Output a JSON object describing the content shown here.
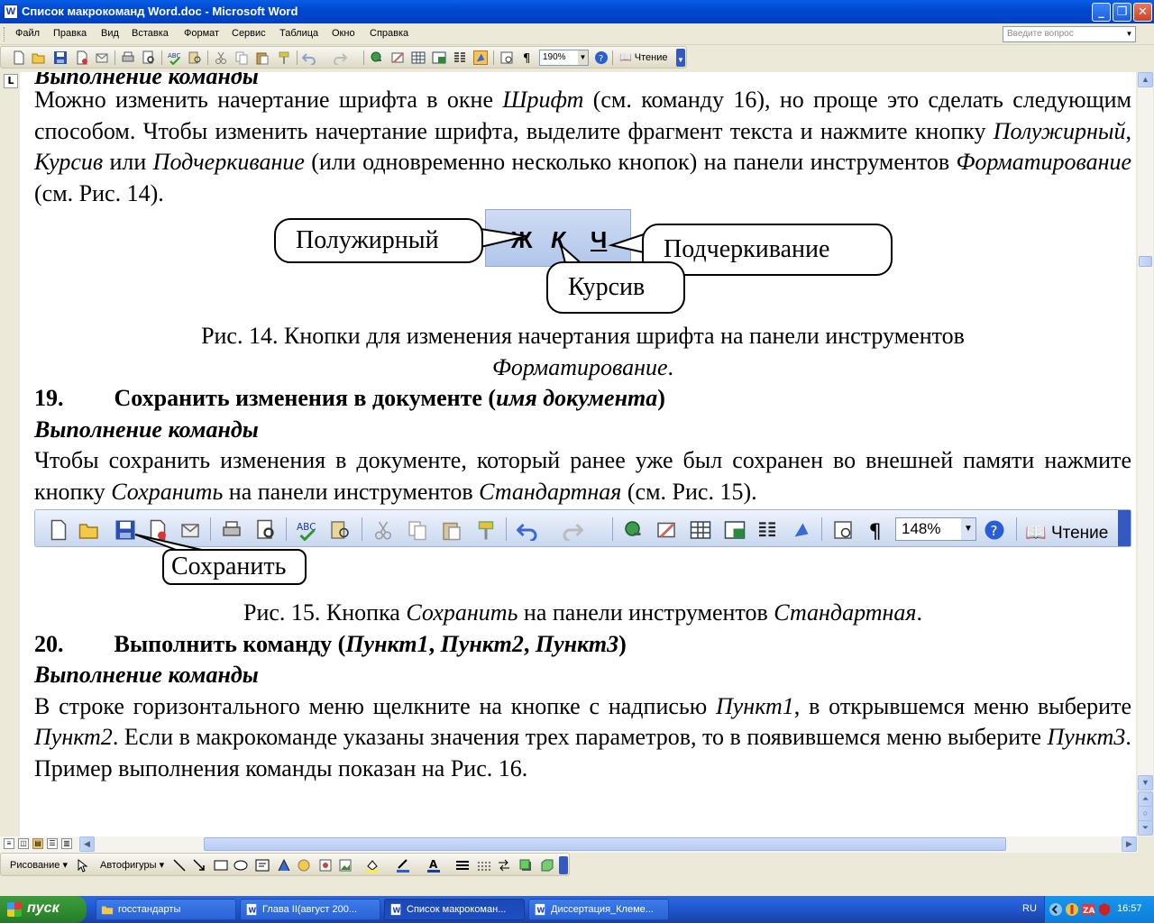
{
  "window": {
    "title": "Список макрокоманд Word.doc - Microsoft Word"
  },
  "menu": {
    "items": [
      "Файл",
      "Правка",
      "Вид",
      "Вставка",
      "Формат",
      "Сервис",
      "Таблица",
      "Окно",
      "Справка"
    ],
    "help_placeholder": "Введите вопрос"
  },
  "toolbar": {
    "zoom": "190%",
    "reading": "Чтение"
  },
  "ruler_tab_symbol": "L",
  "document": {
    "cut_heading": "Выполнение команды",
    "p1": [
      "Можно изменить начертание шрифта в окне ",
      "Шрифт",
      " (см. команду 16), но проще это сделать следующим способом. Чтобы изменить начертание шрифта, выделите фрагмент текста и нажмите кнопку ",
      "Полужирный",
      ", ",
      "Курсив",
      " или ",
      "Подчеркивание",
      " (или одновременно несколько кнопок) на панели инструментов ",
      "Форматирование",
      " (см. Рис. 14)."
    ],
    "fig14": {
      "buttons": [
        "Ж",
        "К",
        "Ч"
      ],
      "callouts": {
        "bold": "Полужирный",
        "underline": "Подчеркивание",
        "italic": "Курсив"
      },
      "caption_line1": "Рис. 14. Кнопки для изменения начертания шрифта на панели инструментов",
      "caption_line2": "Форматирование",
      "caption_end": "."
    },
    "s19": {
      "num": "19.",
      "title": "Сохранить изменения в документе (",
      "param": "имя документа",
      "close": ")"
    },
    "exec_label": "Выполнение команды",
    "p2": [
      "Чтобы сохранить изменения в документе, который ранее уже был сохранен во внешней памяти нажмите кнопку ",
      "Сохранить",
      " на панели инструментов ",
      "Стандартная",
      " (см. Рис. 15)."
    ],
    "fig15": {
      "zoom": "148%",
      "reading": "Чтение",
      "callout": "Сохранить",
      "caption": [
        "Рис. 15. Кнопка ",
        "Сохранить",
        " на панели инструментов ",
        "Стандартная",
        "."
      ]
    },
    "s20": {
      "num": "20.",
      "title": "Выполнить команду (",
      "p1": "Пункт1",
      "sep": ", ",
      "p2": "Пункт2",
      "p3": "Пункт3",
      "close": ")"
    },
    "p3": [
      "В строке горизонтального меню щелкните на кнопке с надписью ",
      "Пункт1",
      ", в открывшемся меню выберите ",
      "Пункт2",
      ". Если в макрокоманде указаны значения трех параметров, то в появившемся меню выберите ",
      "Пункт3",
      "."
    ],
    "p4": "Пример выполнения команды показан на Рис. 16."
  },
  "drawing": {
    "draw": "Рисование",
    "autoshapes": "Автофигуры"
  },
  "taskbar": {
    "start": "пуск",
    "tasks": [
      "госстандарты",
      "Глава II(август 200...",
      "Список макрокоман...",
      "Диссертация_Клеме..."
    ],
    "lang": "RU",
    "clock": "16:57"
  },
  "colors": {
    "titlebar": "#0a5ee6",
    "taskbar": "#245edb",
    "start": "#2e8b2e"
  }
}
